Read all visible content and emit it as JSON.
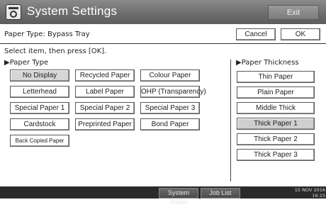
{
  "window": {
    "title": "System Settings",
    "exit_label": "Exit"
  },
  "header": {
    "label": "Paper Type: Bypass Tray",
    "cancel_label": "Cancel",
    "ok_label": "OK"
  },
  "instruction": "Select item, then press [OK].",
  "paper_type": {
    "heading": "Paper Type",
    "options": [
      {
        "label": "No Display",
        "selected": true
      },
      {
        "label": "Recycled Paper",
        "selected": false
      },
      {
        "label": "Colour Paper",
        "selected": false
      },
      {
        "label": "Letterhead",
        "selected": false
      },
      {
        "label": "Label Paper",
        "selected": false
      },
      {
        "label": "OHP (Transparency)",
        "selected": false
      },
      {
        "label": "Special Paper 1",
        "selected": false
      },
      {
        "label": "Special Paper 2",
        "selected": false
      },
      {
        "label": "Special Paper 3",
        "selected": false
      },
      {
        "label": "Cardstock",
        "selected": false
      },
      {
        "label": "Preprinted Paper",
        "selected": false
      },
      {
        "label": "Bond Paper",
        "selected": false
      },
      {
        "label": "Back Copied Paper",
        "selected": false
      }
    ]
  },
  "paper_thickness": {
    "heading": "Paper Thickness",
    "options": [
      {
        "label": "Thin Paper",
        "selected": false
      },
      {
        "label": "Plain Paper",
        "selected": false
      },
      {
        "label": "Middle Thick",
        "selected": false
      },
      {
        "label": "Thick Paper 1",
        "selected": true
      },
      {
        "label": "Thick Paper 2",
        "selected": false
      },
      {
        "label": "Thick Paper 3",
        "selected": false
      }
    ]
  },
  "footer": {
    "system_status_label": "System Status",
    "job_list_label": "Job List",
    "date": "15 NOV  2016",
    "time": "16:15"
  },
  "icons": {
    "section_marker": "▶"
  },
  "colors": {
    "titlebar": "#6e6e6e",
    "selected": "#d6d6d6",
    "footer": "#2a2a2a"
  }
}
